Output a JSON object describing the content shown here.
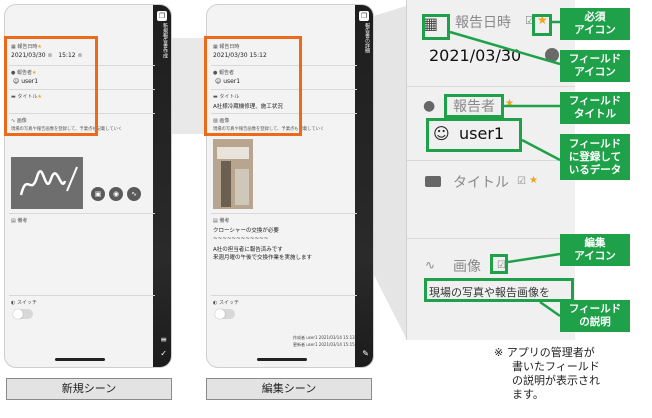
{
  "left_phone": {
    "app_title": "新規報告書作成",
    "date_label": "報告日時",
    "date_value": "2021/03/30",
    "time_value": "15:12",
    "reporter_label": "報告者",
    "reporter_value": "user1",
    "title_label": "タイトル",
    "image_label": "画像",
    "image_desc": "現場の写真や報告画像を登録して、予業点も記載していく",
    "remarks_label": "備考",
    "switch_label": "スイッチ",
    "scene_label": "新規シーン"
  },
  "right_phone": {
    "app_title": "報告書の詳細",
    "date_label": "報告日時",
    "date_value": "2021/03/30 15:12",
    "reporter_label": "報告者",
    "reporter_value": "user1",
    "title_label": "タイトル",
    "title_value": "A社様冷蔵機修理、施工状況",
    "image_label": "画像",
    "image_desc": "現場の写真や報告画像を登録して、予業点も記載していく",
    "remarks_label": "備考",
    "remarks_line1": "クローシャーの交換が必要",
    "remarks_line2": "~~~~~~~~~~~~",
    "remarks_line3": "A社の担当者に報告済みです",
    "remarks_line4": "来週月曜の午後で交換作業を実施します",
    "switch_label": "スイッチ",
    "created_by": "作成者 user1  2021/03/14 15:13",
    "updated_by": "更新者 user1  2021/03/14 15:15",
    "scene_label": "編集シーン"
  },
  "zoom": {
    "date_label": "報告日時",
    "date_value": "2021/03/30",
    "reporter_label": "報告者",
    "reporter_value": "user1",
    "title_label": "タイトル",
    "image_label": "画像",
    "image_desc": "現場の写真や報告画像を"
  },
  "callouts": {
    "required_icon_1": "必須",
    "required_icon_2": "アイコン",
    "field_icon_1": "フィールド",
    "field_icon_2": "アイコン",
    "field_title_1": "フィールド",
    "field_title_2": "タイトル",
    "field_data_1": "フィールド",
    "field_data_2": "に登録して",
    "field_data_3": "いるデータ",
    "edit_icon_1": "編集",
    "edit_icon_2": "アイコン",
    "field_desc_1": "フィールド",
    "field_desc_2": "の説明"
  },
  "note": {
    "mark": "※",
    "line1": "アプリの管理者が",
    "line2": "書いたフィールド",
    "line3": "の説明が表示され",
    "line4": "ます。"
  },
  "colors": {
    "orange": "#ee6a1b",
    "green": "#1fa14a",
    "star": "#f2a21b"
  }
}
